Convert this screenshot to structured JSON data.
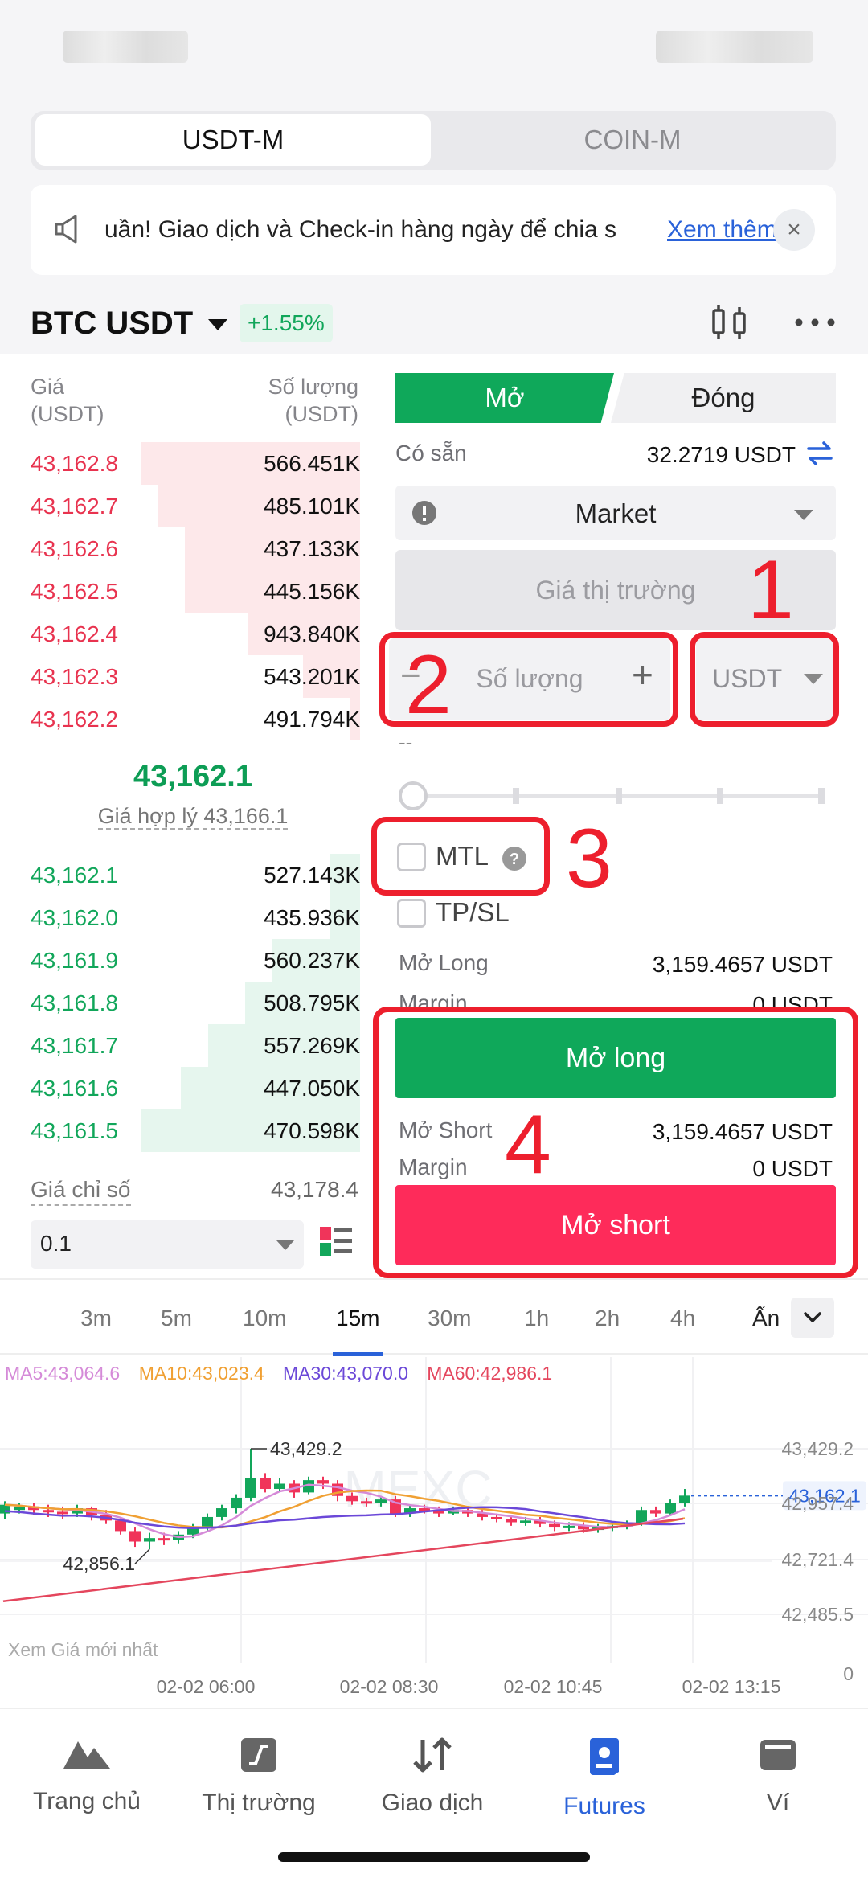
{
  "market_tabs": {
    "active": "USDT-M",
    "inactive": "COIN-M"
  },
  "notice": {
    "text": "uần! Giao dịch và Check-in hàng ngày để chia s",
    "link": "Xem thêm",
    "close": "×"
  },
  "pair": {
    "symbol": "BTC USDT",
    "change": "+1.55%"
  },
  "orderbook": {
    "price_header": "Giá",
    "price_unit": "(USDT)",
    "qty_header": "Số lượng",
    "qty_unit": "(USDT)",
    "asks": [
      {
        "price": "43,162.8",
        "qty": "566.451K",
        "depth": 0.65
      },
      {
        "price": "43,162.7",
        "qty": "485.101K",
        "depth": 0.6
      },
      {
        "price": "43,162.6",
        "qty": "437.133K",
        "depth": 0.52
      },
      {
        "price": "43,162.5",
        "qty": "445.156K",
        "depth": 0.52
      },
      {
        "price": "43,162.4",
        "qty": "943.840K",
        "depth": 0.33
      },
      {
        "price": "43,162.3",
        "qty": "543.201K",
        "depth": 0.17
      },
      {
        "price": "43,162.2",
        "qty": "491.794K",
        "depth": 0.03
      }
    ],
    "last_price": "43,162.1",
    "fair_price": "Giá hợp lý 43,166.1",
    "bids": [
      {
        "price": "43,162.1",
        "qty": "527.143K",
        "depth": 0.09
      },
      {
        "price": "43,162.0",
        "qty": "435.936K",
        "depth": 0.09
      },
      {
        "price": "43,161.9",
        "qty": "560.237K",
        "depth": 0.26
      },
      {
        "price": "43,161.8",
        "qty": "508.795K",
        "depth": 0.34
      },
      {
        "price": "43,161.7",
        "qty": "557.269K",
        "depth": 0.45
      },
      {
        "price": "43,161.6",
        "qty": "447.050K",
        "depth": 0.53
      },
      {
        "price": "43,161.5",
        "qty": "470.598K",
        "depth": 0.65
      }
    ],
    "index_label": "Giá chỉ số",
    "index_value": "43,178.4",
    "precision": "0.1"
  },
  "order_form": {
    "tab_open": "Mở",
    "tab_close": "Đóng",
    "available_label": "Có sẵn",
    "available_value": "32.2719 USDT",
    "order_type": "Market",
    "market_price": "Giá thị trường",
    "qty_placeholder": "Số lượng",
    "minus": "−",
    "plus": "+",
    "unit": "USDT",
    "dash": "--",
    "mtl_label": "MTL",
    "tpsl_label": "TP/SL",
    "open_long_label": "Mở Long",
    "open_long_value": "3,159.4657 USDT",
    "margin_label": "Margin",
    "margin_value": "0 USDT",
    "long_button": "Mở long",
    "open_short_label": "Mở Short",
    "open_short_value": "3,159.4657 USDT",
    "margin2_label": "Margin",
    "margin2_value": "0 USDT",
    "short_button": "Mở short"
  },
  "annotations": [
    "1",
    "2",
    "3",
    "4"
  ],
  "timeframes": {
    "items": [
      "3m",
      "5m",
      "10m",
      "15m",
      "30m",
      "1h",
      "2h",
      "4h"
    ],
    "active": "15m",
    "hide": "Ẩn"
  },
  "chart_data": {
    "type": "candlestick",
    "ma_labels": [
      "MA5:43,064.6",
      "MA10:43,023.4",
      "MA30:43,070.0",
      "MA60:42,986.1"
    ],
    "ma_colors": [
      "#d58ad8",
      "#f0a033",
      "#6b48d8",
      "#e4465d"
    ],
    "y_ticks": [
      "43,429.2",
      "42,957.4",
      "42,721.4",
      "42,485.5",
      "0"
    ],
    "x_ticks": [
      "02-02 06:00",
      "02-02 08:30",
      "02-02 10:45",
      "02-02 13:15"
    ],
    "high_label": "43,429.2",
    "low_label": "42,856.1",
    "current_price": "43,162.1",
    "footer": "Xem Giá mới nhất",
    "watermark": "MEXC",
    "candles": [
      [
        43060,
        43110,
        43030,
        43130
      ],
      [
        43080,
        43100,
        43060,
        43120
      ],
      [
        43100,
        43080,
        43050,
        43120
      ],
      [
        43080,
        43070,
        43040,
        43110
      ],
      [
        43070,
        43060,
        43030,
        43100
      ],
      [
        43060,
        43090,
        43040,
        43110
      ],
      [
        43090,
        43050,
        43020,
        43100
      ],
      [
        43050,
        43020,
        43000,
        43080
      ],
      [
        43020,
        42960,
        42940,
        43040
      ],
      [
        42960,
        42900,
        42870,
        42980
      ],
      [
        42900,
        42920,
        42856,
        42950
      ],
      [
        42920,
        42910,
        42880,
        42950
      ],
      [
        42910,
        42940,
        42890,
        42960
      ],
      [
        42940,
        42980,
        42920,
        43000
      ],
      [
        42980,
        43040,
        42960,
        43060
      ],
      [
        43040,
        43090,
        43020,
        43110
      ],
      [
        43090,
        43150,
        43060,
        43170
      ],
      [
        43150,
        43260,
        43130,
        43429
      ],
      [
        43260,
        43200,
        43180,
        43290
      ],
      [
        43200,
        43230,
        43180,
        43260
      ],
      [
        43230,
        43180,
        43150,
        43250
      ],
      [
        43180,
        43250,
        43170,
        43270
      ],
      [
        43250,
        43230,
        43200,
        43270
      ],
      [
        43230,
        43160,
        43130,
        43250
      ],
      [
        43160,
        43130,
        43110,
        43180
      ],
      [
        43130,
        43120,
        43100,
        43150
      ],
      [
        43120,
        43140,
        43100,
        43160
      ],
      [
        43140,
        43060,
        43040,
        43160
      ],
      [
        43060,
        43090,
        43040,
        43110
      ],
      [
        43090,
        43080,
        43060,
        43110
      ],
      [
        43080,
        43060,
        43040,
        43100
      ],
      [
        43060,
        43080,
        43050,
        43100
      ],
      [
        43080,
        43060,
        43040,
        43100
      ],
      [
        43060,
        43040,
        43020,
        43080
      ],
      [
        43040,
        43030,
        43010,
        43060
      ],
      [
        43030,
        43010,
        42990,
        43050
      ],
      [
        43010,
        43020,
        42990,
        43040
      ],
      [
        43020,
        43000,
        42980,
        43040
      ],
      [
        43000,
        42980,
        42960,
        43020
      ],
      [
        42980,
        42990,
        42960,
        43010
      ],
      [
        42990,
        42970,
        42950,
        43010
      ],
      [
        42970,
        42980,
        42950,
        43000
      ],
      [
        42980,
        42990,
        42960,
        43010
      ],
      [
        42990,
        43000,
        42970,
        43020
      ],
      [
        43000,
        43080,
        42990,
        43100
      ],
      [
        43080,
        43060,
        43040,
        43100
      ],
      [
        43060,
        43120,
        43050,
        43140
      ],
      [
        43120,
        43162,
        43100,
        43200
      ]
    ]
  },
  "bottom_nav": {
    "items": [
      "Trang chủ",
      "Thị trường",
      "Giao dịch",
      "Futures",
      "Ví"
    ],
    "active": "Futures"
  }
}
